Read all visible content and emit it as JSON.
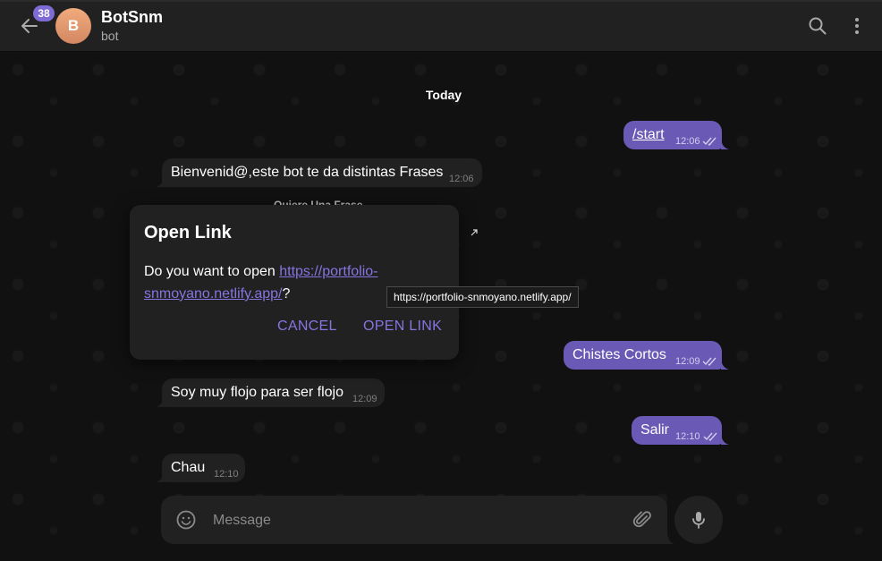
{
  "header": {
    "unread_count": "38",
    "avatar_initial": "B",
    "title": "BotSnm",
    "subtitle": "bot"
  },
  "chat": {
    "date_separator": "Today",
    "messages": [
      {
        "text": "/start",
        "time": "12:06",
        "direction": "out"
      },
      {
        "text": "Bienvenid@,este bot te da distintas Frases",
        "time": "12:06",
        "direction": "in"
      },
      {
        "text": "Chistes Cortos",
        "time": "12:09",
        "direction": "out"
      },
      {
        "text": "Soy muy flojo para ser flojo",
        "time": "12:09",
        "direction": "in"
      },
      {
        "text": "Salir",
        "time": "12:10",
        "direction": "out"
      },
      {
        "text": "Chau",
        "time": "12:10",
        "direction": "in"
      }
    ],
    "partially_hidden_text": "Quiere Una Frase"
  },
  "dialog": {
    "title": "Open Link",
    "body_prefix": "Do you want to open ",
    "url_part1": "https://portfolio-",
    "url_part2": "snmoyano.netlify.app/",
    "body_suffix": "?",
    "cancel_label": "CANCEL",
    "open_label": "OPEN LINK"
  },
  "tooltip": {
    "text": "https://portfolio-snmoyano.netlify.app/"
  },
  "composer": {
    "placeholder": "Message"
  },
  "colors": {
    "accent": "#8774e1",
    "outgoing_bubble": "#6a5ab5",
    "incoming_bubble": "#212121",
    "background": "#111111"
  }
}
